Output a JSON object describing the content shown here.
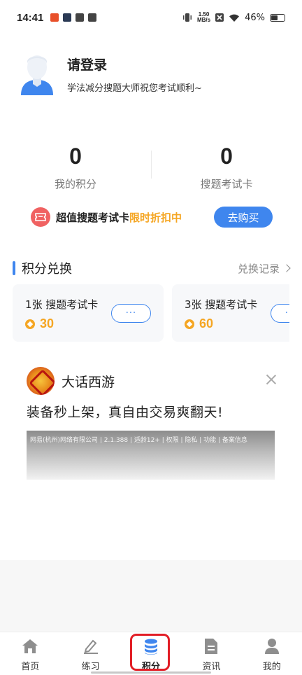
{
  "status_bar": {
    "time": "14:41",
    "net_speed_top": "1.50",
    "net_speed_bottom": "MB/s",
    "battery": "46%"
  },
  "profile": {
    "title": "请登录",
    "subtitle": "学法减分搜题大师祝您考试顺利~"
  },
  "stats": [
    {
      "value": "0",
      "label": "我的积分"
    },
    {
      "value": "0",
      "label": "搜题考试卡"
    }
  ],
  "promo": {
    "text": "超值搜题考试卡",
    "highlight": "限时折扣中",
    "button": "去购买"
  },
  "exchange": {
    "title": "积分兑换",
    "link": "兑换记录",
    "cards": [
      {
        "title": "1张 搜题考试卡",
        "points": "30",
        "more": "···"
      },
      {
        "title": "3张 搜题考试卡",
        "points": "60",
        "more": "···"
      }
    ]
  },
  "ad": {
    "name": "大话西游",
    "headline": "装备秒上架，真自由交易爽翻天!",
    "meta": "网易(杭州)网络有限公司 | 2.1.388 | 适龄12+ | 权限 | 隐私 | 功能 | 备案信息"
  },
  "tabbar": {
    "items": [
      {
        "label": "首页",
        "icon": "home-icon"
      },
      {
        "label": "练习",
        "icon": "pencil-icon"
      },
      {
        "label": "积分",
        "icon": "coins-stack-icon",
        "active": true
      },
      {
        "label": "资讯",
        "icon": "document-icon"
      },
      {
        "label": "我的",
        "icon": "user-icon"
      }
    ]
  },
  "colors": {
    "accent": "#3f86ee",
    "points": "#f5a623",
    "promo_icon": "#f06262",
    "highlight_ring": "#e21e26"
  }
}
